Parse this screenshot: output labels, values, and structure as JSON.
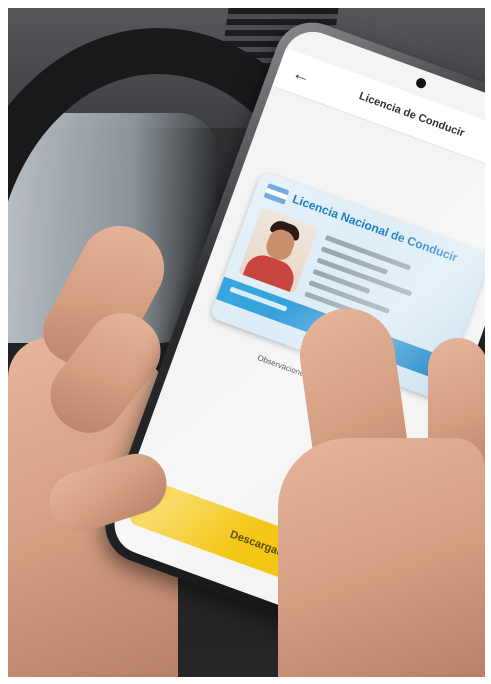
{
  "app": {
    "title": "Licencia de Conducir",
    "back_icon": "back-arrow-icon"
  },
  "license": {
    "title": "Licencia Nacional de Conducir",
    "flag_icon": "argentina-flag-icon",
    "observations": "Observaciones: Anteojos - Ninguna"
  },
  "download": {
    "label": "Descargar"
  },
  "colors": {
    "accent_yellow": "#f4c716",
    "card_blue": "#1d7dc4",
    "stripe_blue": "#39a7e0"
  }
}
